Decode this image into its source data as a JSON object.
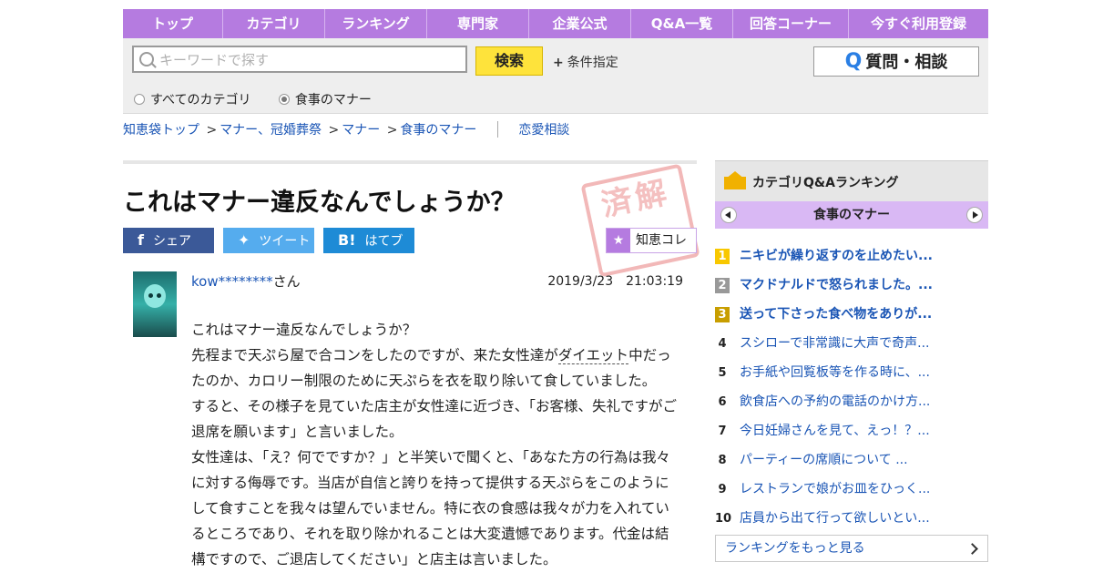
{
  "nav": [
    "トップ",
    "カテゴリ",
    "ランキング",
    "専門家",
    "企業公式",
    "Q&A一覧",
    "回答コーナー",
    "今すぐ利用登録"
  ],
  "search": {
    "placeholder": "キーワードで探す",
    "button": "検索",
    "conditions": "条件指定",
    "ask_button": "質問・相談",
    "radio_all": "すべてのカテゴリ",
    "radio_current": "食事のマナー"
  },
  "breadcrumb": {
    "items": [
      "知恵袋トップ",
      "マナー、冠婚葬祭",
      "マナー",
      "食事のマナー"
    ],
    "separator": ">",
    "extra": "恋愛相談"
  },
  "question": {
    "title": "これはマナー違反なんでしょうか？",
    "stamp": "済解",
    "share": {
      "facebook": "シェア",
      "twitter": "ツイート",
      "hatena": "はてブ",
      "collect": "知恵コレ"
    },
    "user": "kow********",
    "user_suffix": "さん",
    "date": "2019/3/23　21:03:19",
    "paragraphs": [
      "これはマナー違反なんでしょうか？",
      "先程まで天ぷら屋で合コンをしたのですが、来た女性達がダイエット中だったのか、カロリー制限のために天ぷらを衣を取り除いて食していました。",
      "すると、その様子を見ていた店主が女性達に近づき、「お客様、失礼ですがご退席を願います」と言いました。",
      "女性達は、「え？何でですか？」と半笑いで聞くと、「あなた方の行為は我々に対する侮辱です。当店が自信と誇りを持って提供する天ぷらをこのようにして食すことを我々は望んでいません。特に衣の食感は我々が力を入れているところであり、それを取り除かれることは大変遺憾であります。代金は結構ですので、ご退店してください」と店主は言いました。"
    ],
    "underlined_word": "ダイエット"
  },
  "sidebar": {
    "title": "カテゴリQ&Aランキング",
    "category": "食事のマナー",
    "items": [
      {
        "rank": "1",
        "title": "ニキビが繰り返すのを止めたい..."
      },
      {
        "rank": "2",
        "title": "マクドナルドで怒られました。..."
      },
      {
        "rank": "3",
        "title": "送って下さった食べ物をありが..."
      },
      {
        "rank": "4",
        "title": "スシローで非常識に大声で奇声..."
      },
      {
        "rank": "5",
        "title": "お手紙や回覧板等を作る時に、..."
      },
      {
        "rank": "6",
        "title": "飲食店への予約の電話のかけ方..."
      },
      {
        "rank": "7",
        "title": "今日妊婦さんを見て、えっ！？..."
      },
      {
        "rank": "8",
        "title": "パーティーの席順について ..."
      },
      {
        "rank": "9",
        "title": "レストランで娘がお皿をひっく..."
      },
      {
        "rank": "10",
        "title": "店員から出て行って欲しいとい..."
      }
    ],
    "more": "ランキングをもっと見る"
  }
}
